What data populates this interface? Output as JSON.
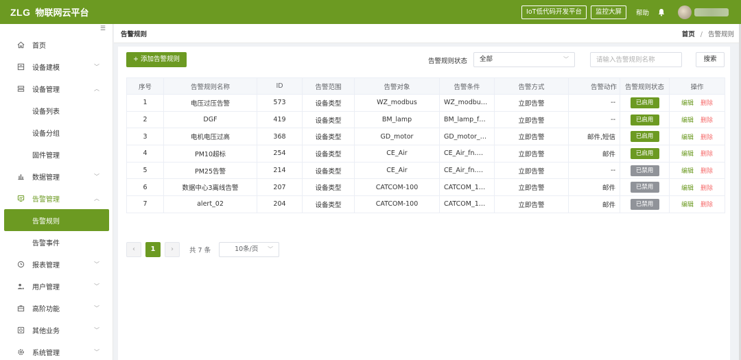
{
  "header": {
    "logo_mark": "ZLG",
    "logo_name": "物联网云平台",
    "lowcode_btn": "IoT低代码开发平台",
    "monitor_btn": "监控大屏",
    "help": "帮助",
    "bell_icon": "bell-icon"
  },
  "sidebar": {
    "collapse_icon": "menu-fold-icon",
    "items": [
      {
        "label": "首页",
        "icon": "home-icon"
      },
      {
        "label": "设备建模",
        "icon": "model-icon"
      },
      {
        "label": "设备管理",
        "icon": "device-icon"
      },
      {
        "label": "设备列表"
      },
      {
        "label": "设备分组"
      },
      {
        "label": "固件管理"
      },
      {
        "label": "数据管理",
        "icon": "bar-chart-icon"
      },
      {
        "label": "告警管理",
        "icon": "alarm-icon"
      },
      {
        "label": "告警规则"
      },
      {
        "label": "告警事件"
      },
      {
        "label": "报表管理",
        "icon": "clock-icon"
      },
      {
        "label": "用户管理",
        "icon": "user-icon"
      },
      {
        "label": "高阶功能",
        "icon": "briefcase-icon"
      },
      {
        "label": "其他业务",
        "icon": "other-icon"
      },
      {
        "label": "系统管理",
        "icon": "settings-icon"
      }
    ]
  },
  "page": {
    "title": "告警规则",
    "breadcrumb_home": "首页",
    "breadcrumb_sep": "/",
    "breadcrumb_current": "告警规则"
  },
  "toolbar": {
    "add_btn": "+ 添加告警规则",
    "status_label": "告警规则状态",
    "status_value": "全部",
    "search_placeholder": "请输入告警规则名称",
    "search_btn": "搜索"
  },
  "table": {
    "headers": [
      "序号",
      "告警规则名称",
      "ID",
      "告警范围",
      "告警对象",
      "告警条件",
      "告警方式",
      "告警动作",
      "告警规则状态",
      "操作"
    ],
    "rows": [
      {
        "no": "1",
        "name": "电压过压告警",
        "id": "573",
        "scope": "设备类型",
        "target": "WZ_modbus",
        "cond": "WZ_modbu…",
        "mode": "立即告警",
        "action": "--",
        "status": "已启用",
        "on": true
      },
      {
        "no": "2",
        "name": "DGF",
        "id": "419",
        "scope": "设备类型",
        "target": "BM_lamp",
        "cond": "BM_lamp_f…",
        "mode": "立即告警",
        "action": "--",
        "status": "已启用",
        "on": true
      },
      {
        "no": "3",
        "name": "电机电压过高",
        "id": "368",
        "scope": "设备类型",
        "target": "GD_motor",
        "cond": "GD_motor_…",
        "mode": "立即告警",
        "action": "邮件,短信",
        "status": "已启用",
        "on": true
      },
      {
        "no": "4",
        "name": "PM10超标",
        "id": "254",
        "scope": "设备类型",
        "target": "CE_Air",
        "cond": "CE_Air_fn.…",
        "mode": "立即告警",
        "action": "邮件",
        "status": "已启用",
        "on": true
      },
      {
        "no": "5",
        "name": "PM25告警",
        "id": "214",
        "scope": "设备类型",
        "target": "CE_Air",
        "cond": "CE_Air_fn.…",
        "mode": "立即告警",
        "action": "--",
        "status": "已禁用",
        "on": false
      },
      {
        "no": "6",
        "name": "数据中心3离线告警",
        "id": "207",
        "scope": "设备类型",
        "target": "CATCOM-100",
        "cond": "CATCOM_1…",
        "mode": "立即告警",
        "action": "邮件",
        "status": "已禁用",
        "on": false
      },
      {
        "no": "7",
        "name": "alert_02",
        "id": "204",
        "scope": "设备类型",
        "target": "CATCOM-100",
        "cond": "CATCOM_1…",
        "mode": "立即告警",
        "action": "邮件",
        "status": "已禁用",
        "on": false
      }
    ],
    "edit_label": "编辑",
    "delete_label": "删除"
  },
  "pagination": {
    "prev": "‹",
    "current": "1",
    "next": "›",
    "total": "共 7 条",
    "page_size": "10条/页"
  },
  "colors": {
    "brand": "#6c9a22",
    "danger": "#f56c6c",
    "disabled": "#909399"
  }
}
